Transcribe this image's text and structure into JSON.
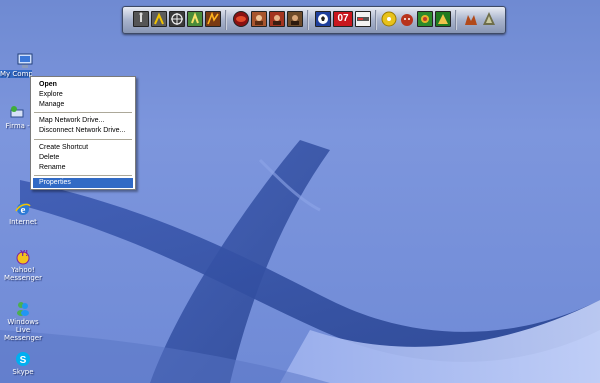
{
  "desktop": {
    "icons": [
      {
        "label": "My Computer",
        "icon": "computer-icon"
      },
      {
        "label": "Firma - 0",
        "icon": "network-icon"
      },
      {
        "label": "Internet",
        "icon": "ie-icon"
      },
      {
        "label": "Yahoo! Messenger",
        "icon": "yahoo-messenger-icon"
      },
      {
        "label": "Windows Live Messenger",
        "icon": "msn-messenger-icon"
      },
      {
        "label": "Skype",
        "icon": "skype-icon"
      }
    ]
  },
  "dock": {
    "badge_text": "07",
    "items": [
      "counter-strike-icon",
      "game-icon",
      "crosshair-icon",
      "half-life-icon",
      "game-icon",
      "game-icon",
      "game-icon",
      "game-icon",
      "game-icon",
      "soccer-ball-icon",
      "pes-07-icon",
      "disk-tool-icon",
      "cd-icon",
      "game-icon",
      "game-icon",
      "game-icon",
      "game-icon",
      "game-icon"
    ]
  },
  "context_menu": {
    "groups": [
      [
        {
          "label": "Open",
          "bold": true
        },
        {
          "label": "Explore"
        },
        {
          "label": "Manage"
        }
      ],
      [
        {
          "label": "Map Network Drive..."
        },
        {
          "label": "Disconnect Network Drive..."
        }
      ],
      [
        {
          "label": "Create Shortcut"
        },
        {
          "label": "Delete"
        },
        {
          "label": "Rename"
        }
      ],
      [
        {
          "label": "Properties",
          "selected": true
        }
      ]
    ]
  },
  "colors": {
    "desktop_blue": "#7189d4",
    "selection_blue": "#316ac5",
    "menu_bg": "#ffffff"
  }
}
